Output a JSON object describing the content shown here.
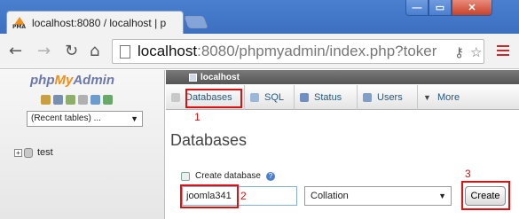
{
  "browser": {
    "tab_title": "localhost:8080 / localhost | p",
    "window_controls": {
      "minimize": "—",
      "maximize": "▭",
      "close": "✕"
    },
    "url_host": "localhost",
    "url_path": ":8080/phpmyadmin/index.php?toker"
  },
  "left": {
    "logo_php": "php",
    "logo_my": "My",
    "logo_admin": "Admin",
    "recent_tables": "(Recent tables) ...",
    "tree_item": "test"
  },
  "main": {
    "server": "localhost",
    "tabs": {
      "databases": "Databases",
      "sql": "SQL",
      "status": "Status",
      "users": "Users",
      "more": "More"
    },
    "page_title": "Databases",
    "create_label": "Create database",
    "db_name_value": "joomla341",
    "collation": "Collation",
    "create_button": "Create"
  },
  "annotations": {
    "n1": "1",
    "n2": "2",
    "n3": "3"
  },
  "colors": {
    "annotation_red": "#e01010",
    "chrome_blue": "#4a7fcf",
    "pma_link": "#235a81"
  }
}
